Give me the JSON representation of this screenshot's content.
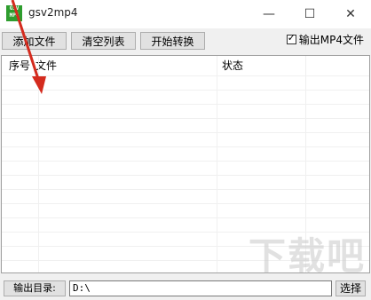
{
  "window": {
    "title": "gsv2mp4",
    "icon_text": "GSV MP4",
    "minimize_icon": "minimize-icon",
    "maximize_icon": "maximize-icon",
    "close_icon": "close-icon"
  },
  "toolbar": {
    "add_file": "添加文件",
    "clear_list": "清空列表",
    "start_convert": "开始转换",
    "output_mp4_label": "输出MP4文件",
    "output_mp4_checked": true
  },
  "list": {
    "columns": [
      "序号",
      "文件",
      "状态"
    ]
  },
  "footer": {
    "output_dir_label": "输出目录:",
    "output_dir_value": "D:\\",
    "choose_button": "选择"
  },
  "watermark": {
    "text": "下载吧"
  },
  "colors": {
    "accent_arrow": "#d42b1e",
    "icon_green": "#2e9d2e"
  }
}
